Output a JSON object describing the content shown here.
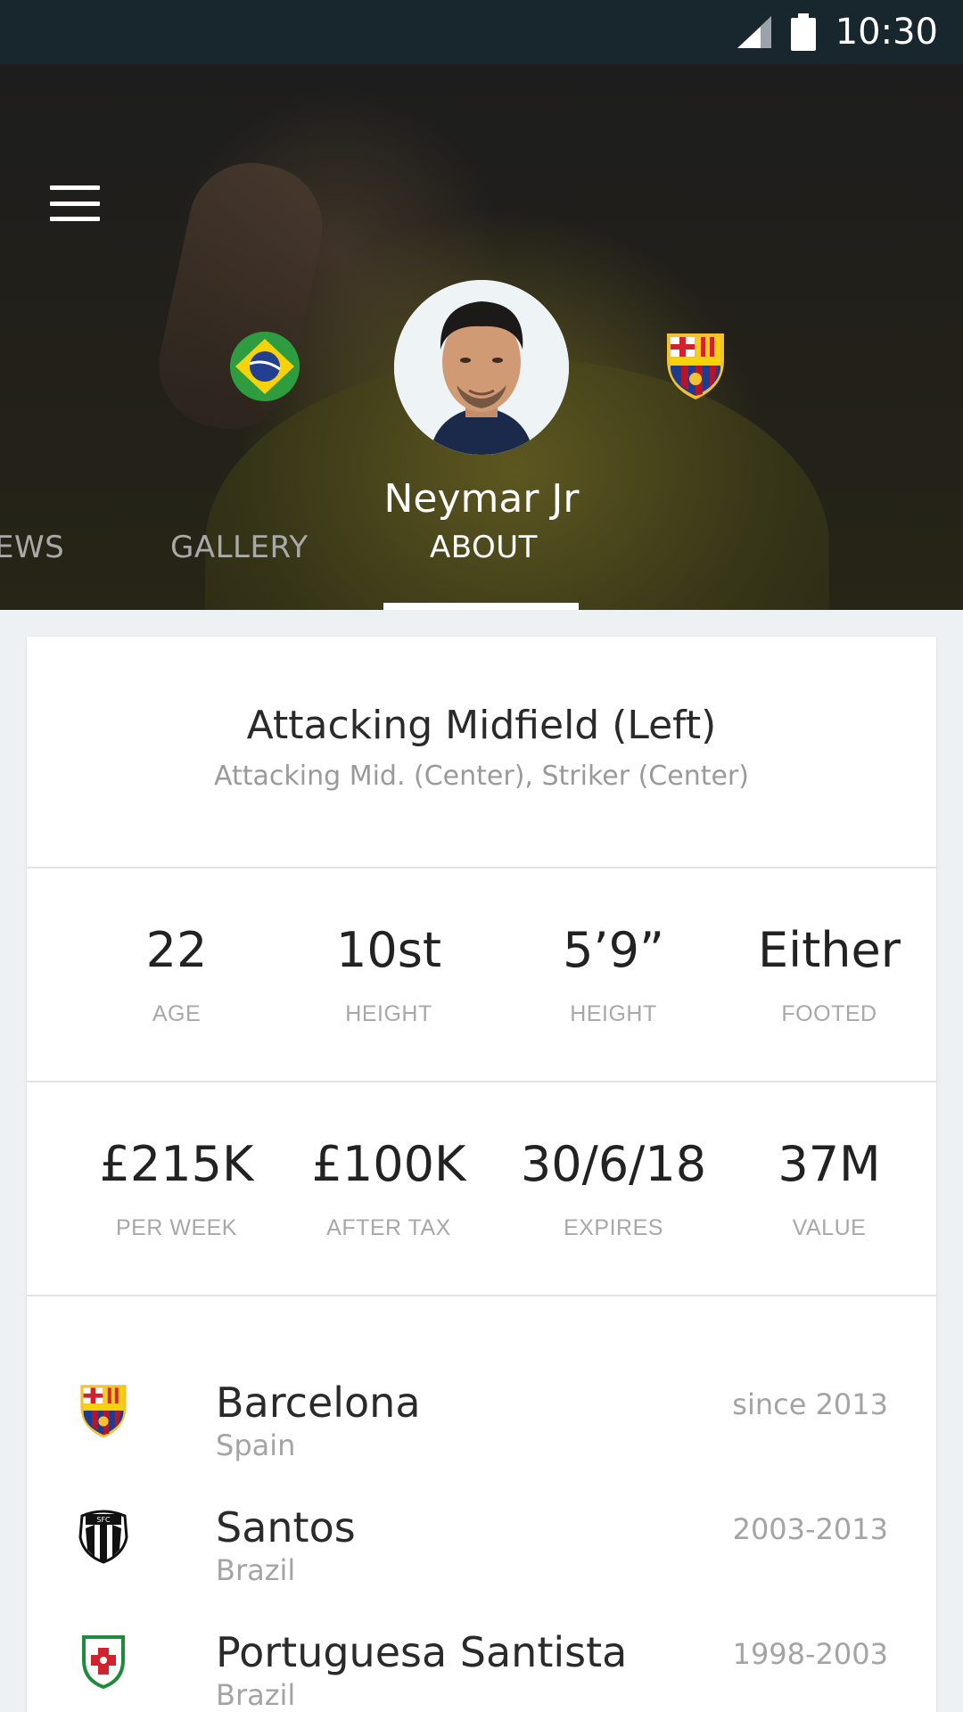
{
  "status_bar": {
    "time": "10:30"
  },
  "player": {
    "name": "Neymar Jr"
  },
  "tabs": [
    {
      "label": "EWS"
    },
    {
      "label": "GALLERY"
    },
    {
      "label": "ABOUT"
    }
  ],
  "position": {
    "primary": "Attacking Midfield (Left)",
    "secondary": "Attacking Mid. (Center), Striker (Center)"
  },
  "stats_row_1": [
    {
      "value": "22",
      "label": "AGE"
    },
    {
      "value": "10st",
      "label": "HEIGHT"
    },
    {
      "value": "5’9”",
      "label": "HEIGHT"
    },
    {
      "value": "Either",
      "label": "FOOTED"
    }
  ],
  "stats_row_2": [
    {
      "value": "£215K",
      "label": "PER WEEK"
    },
    {
      "value": "£100K",
      "label": "AFTER TAX"
    },
    {
      "value": "30/6/18",
      "label": "EXPIRES"
    },
    {
      "value": "37M",
      "label": "VALUE"
    }
  ],
  "clubs": [
    {
      "name": "Barcelona",
      "country": "Spain",
      "period": "since 2013",
      "icon": "barcelona-crest-icon"
    },
    {
      "name": "Santos",
      "country": "Brazil",
      "period": "2003-2013",
      "icon": "santos-crest-icon"
    },
    {
      "name": "Portuguesa Santista",
      "country": "Brazil",
      "period": "1998-2003",
      "icon": "portuguesa-crest-icon"
    }
  ],
  "colors": {
    "status_bar": "#18262e",
    "background": "#eef1f4",
    "active_tab": "#ffffff",
    "inactive_tab": "#a9a9a9",
    "muted_text": "#a4a4a4"
  }
}
